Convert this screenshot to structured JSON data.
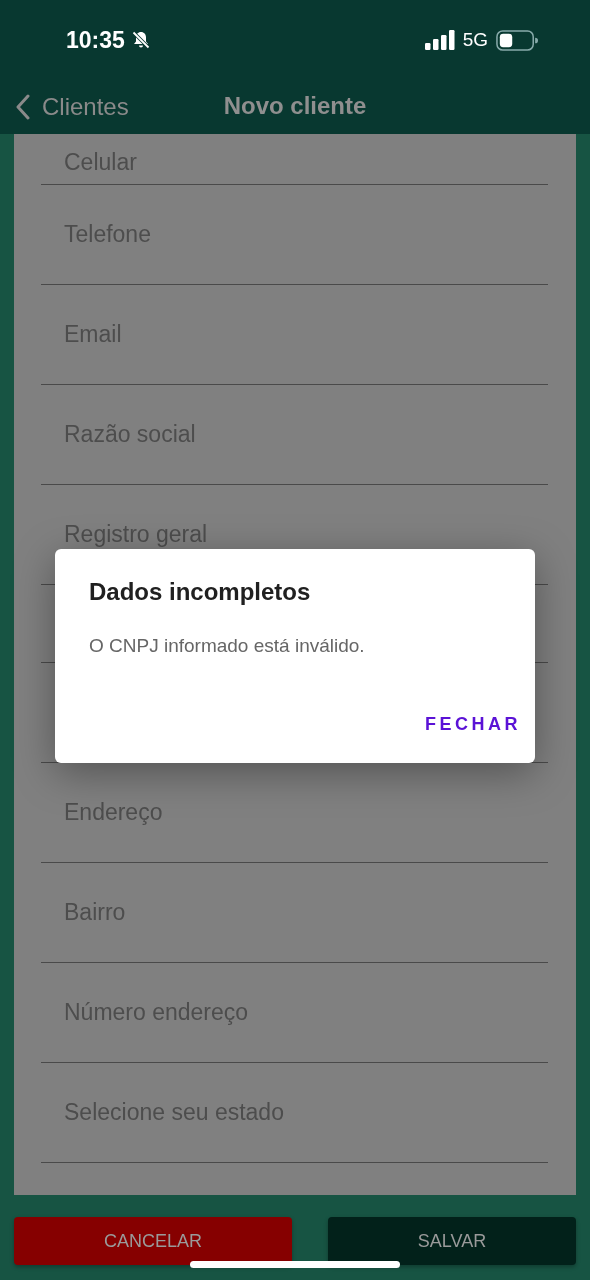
{
  "status_bar": {
    "time": "10:35",
    "network": "5G"
  },
  "nav_bar": {
    "back_label": "Clientes",
    "title": "Novo cliente"
  },
  "fields_above": [
    {
      "placeholder": "Celular"
    },
    {
      "placeholder": "Telefone"
    },
    {
      "placeholder": "Email"
    },
    {
      "placeholder": "Razão social"
    },
    {
      "placeholder": "Registro geral"
    }
  ],
  "fields_below": [
    {
      "placeholder": "Endereço"
    },
    {
      "placeholder": "Bairro"
    },
    {
      "placeholder": "Número endereço"
    },
    {
      "placeholder": "Selecione seu estado"
    }
  ],
  "dialog": {
    "title": "Dados incompletos",
    "message": "O CNPJ informado está inválido.",
    "button": "FECHAR"
  },
  "buttons": [
    {
      "label": "CANCELAR",
      "kind": "cancel"
    },
    {
      "label": "SALVAR",
      "kind": "save"
    }
  ]
}
